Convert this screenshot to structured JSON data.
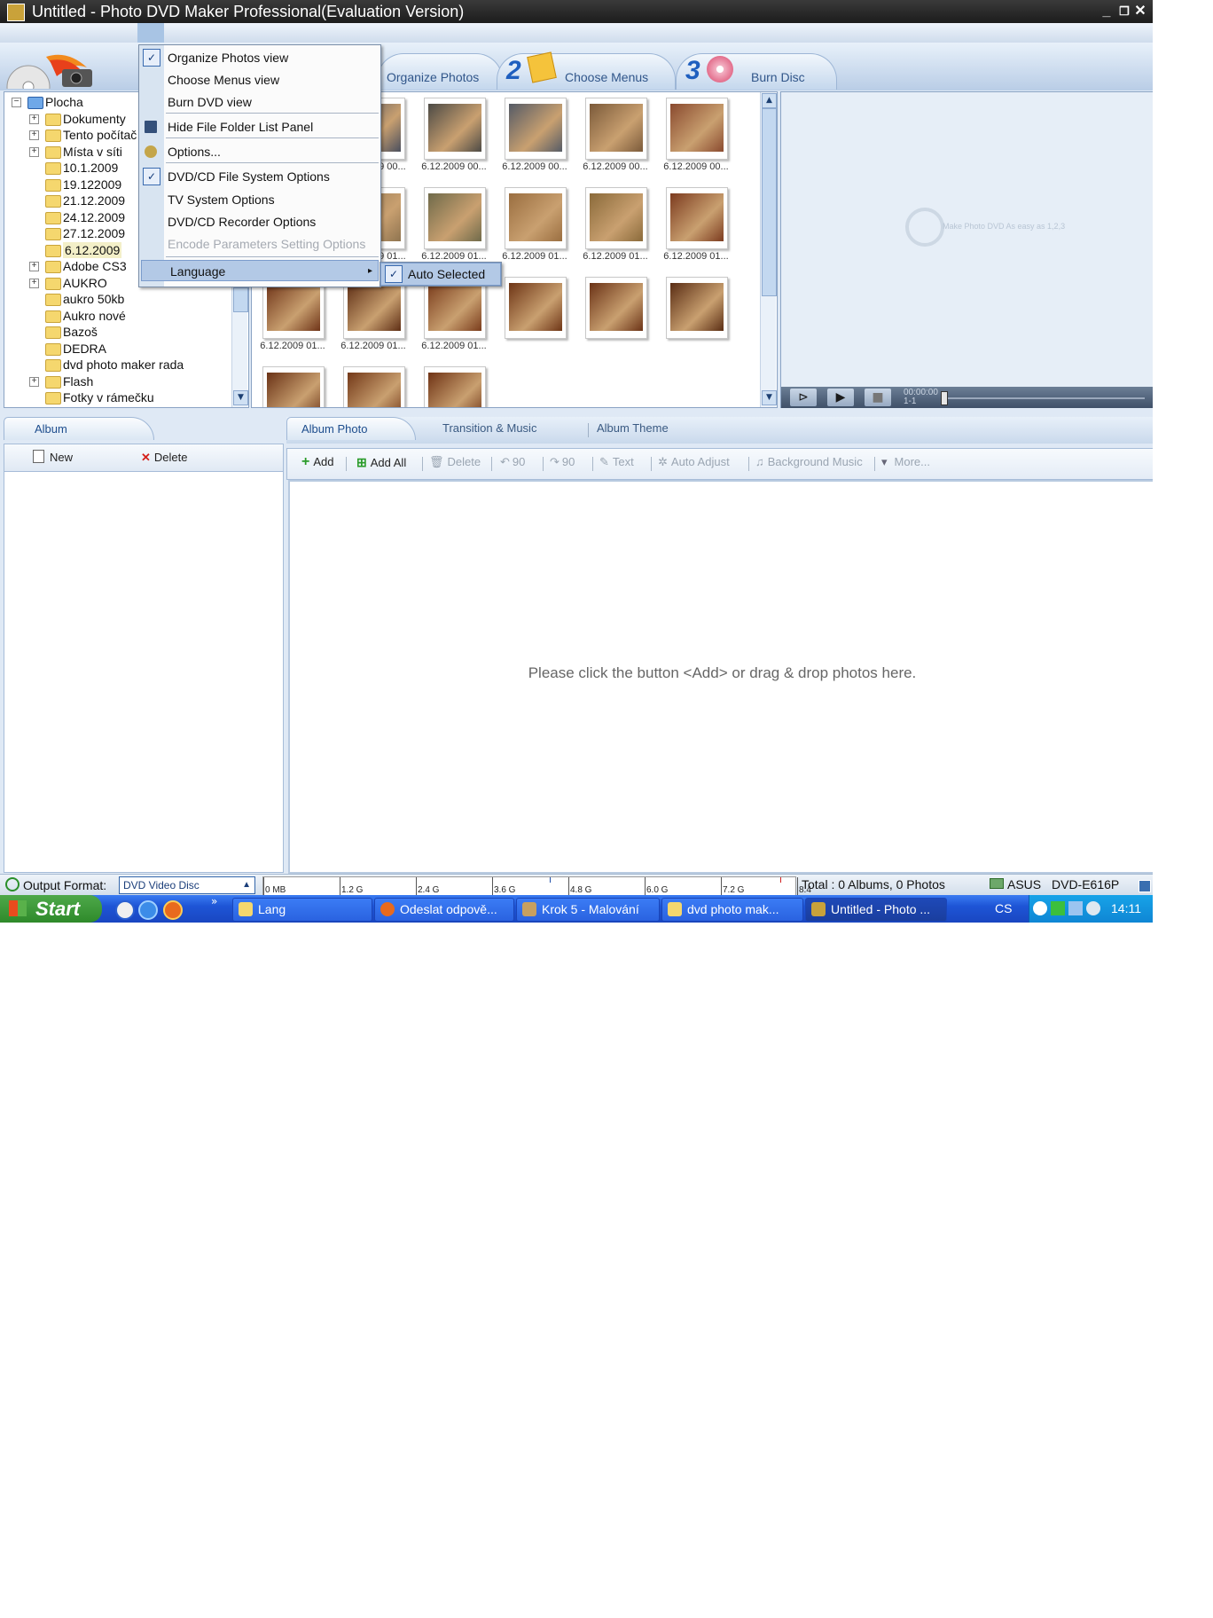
{
  "window": {
    "title": "Untitled - Photo DVD Maker Professional(Evaluation Version)"
  },
  "steps": [
    {
      "num": "",
      "label": "Organize Photos"
    },
    {
      "num": "2",
      "label": "Choose Menus"
    },
    {
      "num": "3",
      "label": "Burn Disc"
    }
  ],
  "tree": [
    {
      "label": "Plocha",
      "indent": 0,
      "exp": "−"
    },
    {
      "label": "Dokumenty",
      "indent": 1,
      "exp": "+"
    },
    {
      "label": "Tento počítač",
      "indent": 1,
      "exp": "+"
    },
    {
      "label": "Místa v síti",
      "indent": 1,
      "exp": "+"
    },
    {
      "label": "10.1.2009",
      "indent": 1,
      "exp": ""
    },
    {
      "label": "19.122009",
      "indent": 1,
      "exp": ""
    },
    {
      "label": "21.12.2009",
      "indent": 1,
      "exp": ""
    },
    {
      "label": "24.12.2009",
      "indent": 1,
      "exp": ""
    },
    {
      "label": "27.12.2009",
      "indent": 1,
      "exp": ""
    },
    {
      "label": "6.12.2009",
      "indent": 1,
      "exp": ""
    },
    {
      "label": "Adobe CS3",
      "indent": 1,
      "exp": "+"
    },
    {
      "label": "AUKRO",
      "indent": 1,
      "exp": "+"
    },
    {
      "label": "aukro 50kb",
      "indent": 1,
      "exp": ""
    },
    {
      "label": "Aukro nové",
      "indent": 1,
      "exp": ""
    },
    {
      "label": "Bazoš",
      "indent": 1,
      "exp": ""
    },
    {
      "label": "DEDRA",
      "indent": 1,
      "exp": ""
    },
    {
      "label": "dvd photo maker rada",
      "indent": 1,
      "exp": ""
    },
    {
      "label": "Flash",
      "indent": 1,
      "exp": "+"
    },
    {
      "label": "Fotky v rámečku",
      "indent": 1,
      "exp": ""
    }
  ],
  "thumbnails": [
    {
      "caption": "6.12.2009 00...",
      "color": "#3b3f4a"
    },
    {
      "caption": "6.12.2009 00...",
      "color": "#4a4f5e"
    },
    {
      "caption": "6.12.2009 00...",
      "color": "#4c4a45"
    },
    {
      "caption": "6.12.2009 00...",
      "color": "#555b66"
    },
    {
      "caption": "6.12.2009 00...",
      "color": "#7b5a3a"
    },
    {
      "caption": "6.12.2009 00...",
      "color": "#8a4a2f"
    },
    {
      "caption": "6.12.2009 00...",
      "color": "#9a7a55"
    },
    {
      "caption": "6.12.2009 01...",
      "color": "#8f7450"
    },
    {
      "caption": "6.12.2009 01...",
      "color": "#6f6a4a"
    },
    {
      "caption": "6.12.2009 01...",
      "color": "#9a6e40"
    },
    {
      "caption": "6.12.2009 01...",
      "color": "#8a6a3a"
    },
    {
      "caption": "6.12.2009 01...",
      "color": "#7c3b1f"
    },
    {
      "caption": "6.12.2009 01...",
      "color": "#6f3418"
    },
    {
      "caption": "6.12.2009 01...",
      "color": "#5e2e15"
    },
    {
      "caption": "6.12.2009 01...",
      "color": "#7a3c1c"
    },
    {
      "caption": "",
      "color": "#6e3516"
    },
    {
      "caption": "",
      "color": "#6b3317"
    },
    {
      "caption": "",
      "color": "#5a2d14"
    },
    {
      "caption": "",
      "color": "#6a3216"
    },
    {
      "caption": "",
      "color": "#733818"
    },
    {
      "caption": "",
      "color": "#6f3315"
    }
  ],
  "preview": {
    "watermark": "Make Photo DVD As easy as 1,2,3",
    "time": "00:00:00",
    "frame": "1-1"
  },
  "album": {
    "tab": "Album",
    "new": "New",
    "delete": "Delete"
  },
  "photo_tabs": [
    "Album Photo",
    "Transition & Music",
    "Album Theme"
  ],
  "photo_tools": {
    "add": "Add",
    "add_all": "Add All",
    "delete": "Delete",
    "rot_left": "90",
    "rot_right": "90",
    "text": "Text",
    "auto_adjust": "Auto Adjust",
    "bg_music": "Background Music",
    "more": "More..."
  },
  "dropzone": {
    "message": "Please click the button <Add> or drag & drop photos here."
  },
  "status": {
    "output_label": "Output Format:",
    "output_value": "DVD Video Disc",
    "ticks": [
      "0 MB",
      "1.2 G",
      "2.4 G",
      "3.6 G",
      "4.8 G",
      "6.0 G",
      "7.2 G",
      "8.4 G"
    ],
    "total": "Total : 0 Albums, 0 Photos",
    "drive_brand": "ASUS",
    "drive_model": "DVD-E616P"
  },
  "menu": {
    "items": [
      {
        "label": "Organize Photos view",
        "checked": true
      },
      {
        "label": "Choose Menus view"
      },
      {
        "label": "Burn DVD view"
      },
      {
        "label": "Hide File Folder List Panel"
      },
      {
        "label": "Options..."
      },
      {
        "label": "DVD/CD File System Options",
        "checked": true
      },
      {
        "label": "TV System Options"
      },
      {
        "label": "DVD/CD Recorder Options"
      },
      {
        "label": "Encode Parameters Setting Options",
        "disabled": true
      },
      {
        "label": "Language"
      }
    ],
    "submenu": {
      "label": "Auto Selected"
    }
  },
  "taskbar": {
    "start": "Start",
    "tasks": [
      "Lang",
      "Odeslat odpově...",
      "Krok 5 - Malování",
      "dvd photo mak...",
      "Untitled - Photo ..."
    ],
    "lang": "CS",
    "clock": "14:11"
  },
  "colors": {
    "accent": "#1f5fbf",
    "menu_hover": "#b3c9e6",
    "taskbar": "#2a62e0"
  }
}
